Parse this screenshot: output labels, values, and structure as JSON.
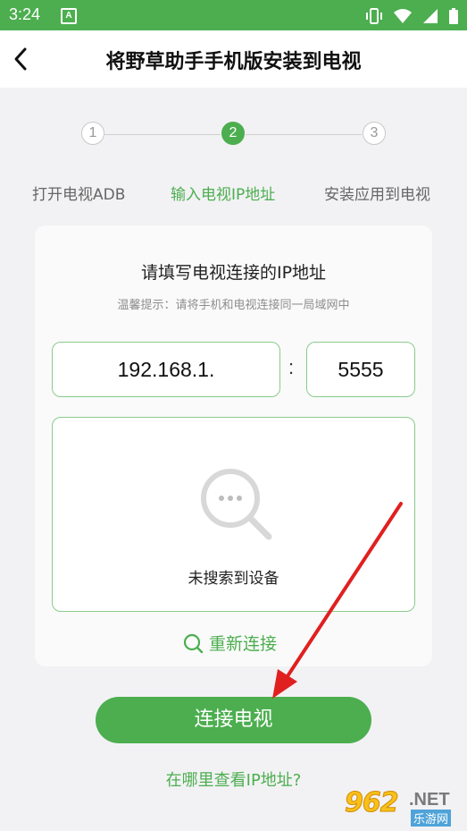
{
  "status_bar": {
    "time": "3:24",
    "notification_glyph": "A"
  },
  "app_bar": {
    "title": "将野草助手手机版安装到电视"
  },
  "steps": [
    {
      "number": "1",
      "label": "打开电视ADB",
      "active": false
    },
    {
      "number": "2",
      "label": "输入电视IP地址",
      "active": true
    },
    {
      "number": "3",
      "label": "安装应用到电视",
      "active": false
    }
  ],
  "card": {
    "title": "请填写电视连接的IP地址",
    "tip": "温馨提示：请将手机和电视连接同一局域网中",
    "ip_value": "192.168.1.",
    "separator": ":",
    "port_value": "5555",
    "empty_text": "未搜索到设备",
    "reconnect_label": "重新连接"
  },
  "connect_button": {
    "label": "连接电视"
  },
  "help_link": {
    "label": "在哪里查看IP地址?"
  },
  "watermark": {
    "number": "962",
    "domain": ".NET",
    "site": "乐游网"
  },
  "colors": {
    "accent": "#4cae4f",
    "arrow": "#e02020"
  }
}
